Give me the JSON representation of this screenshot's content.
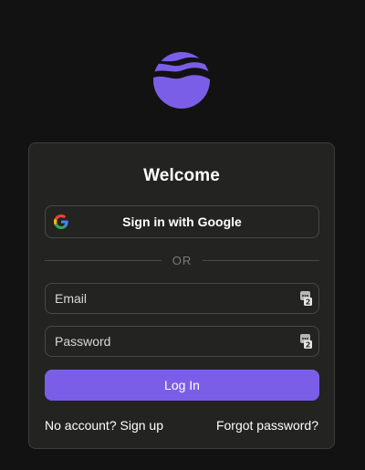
{
  "logo": {
    "icon": "wave-globe-logo",
    "color": "#7b5ee8"
  },
  "card": {
    "title": "Welcome",
    "google_button": {
      "label": "Sign in with Google",
      "icon": "google-icon"
    },
    "divider_text": "OR",
    "email": {
      "placeholder": "Email",
      "value": ""
    },
    "password": {
      "placeholder": "Password",
      "value": ""
    },
    "password_manager_icon": "password-manager-key-icon",
    "login_button": {
      "label": "Log In",
      "color": "#7b5ee8"
    },
    "signup_link": "No account? Sign up",
    "forgot_link": "Forgot password?"
  },
  "colors": {
    "background": "#121212",
    "card": "#232322",
    "accent": "#7b5ee8"
  }
}
